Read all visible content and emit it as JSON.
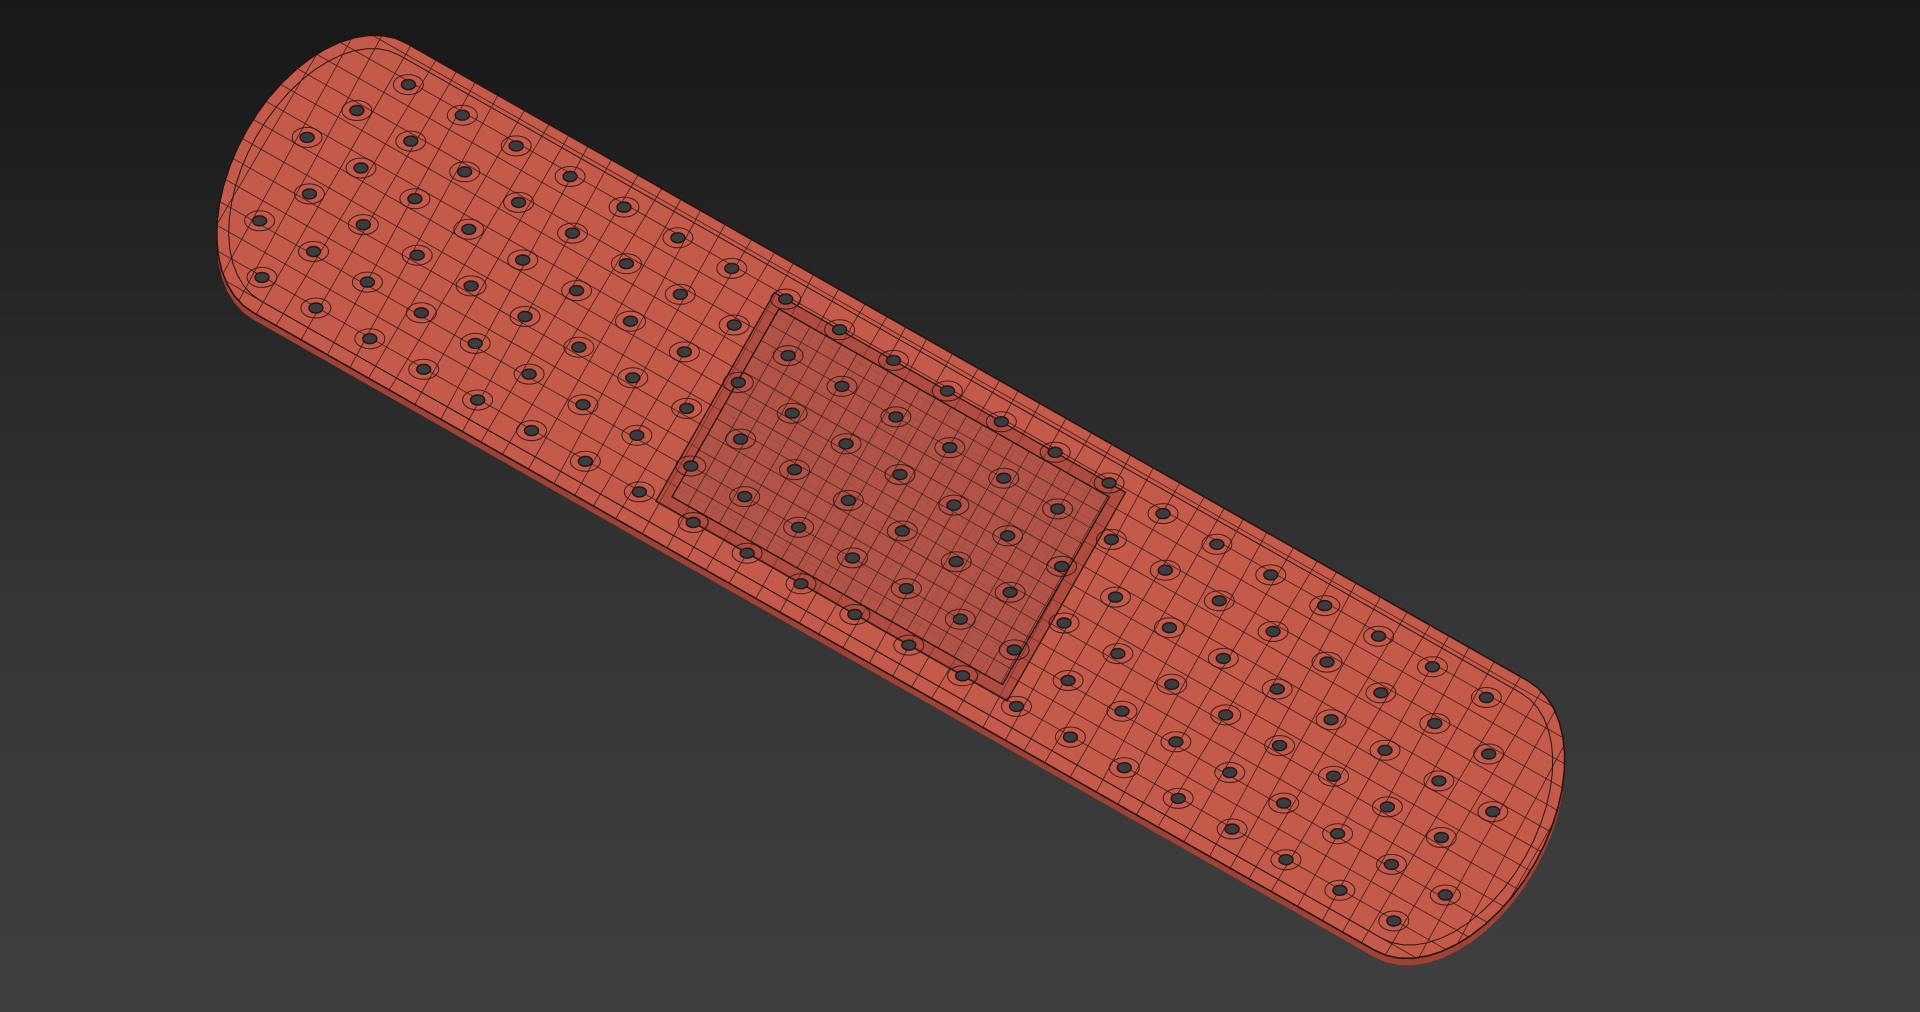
{
  "viewport": {
    "background_top": "#171717",
    "background_bottom": "#3f3f3f"
  },
  "model": {
    "object": "adhesive-bandage",
    "display_mode": "shaded-with-wireframe",
    "surface_color": "#c45a4a",
    "surface_shadow_color": "#9e4236",
    "wire_color": "#2a1210",
    "hole_fill_color": "#3a3d3f",
    "pad_tint_color": "#b3574b"
  }
}
